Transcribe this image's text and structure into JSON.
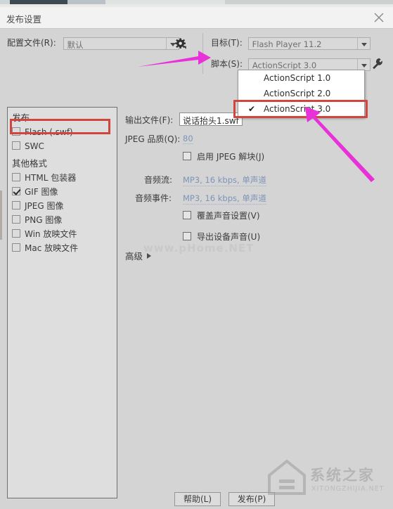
{
  "window": {
    "title": "发布设置",
    "close_icon": "close-icon"
  },
  "toolbar": {
    "profile_label": "配置文件(R):",
    "profile_value": "默认",
    "gear_icon": "gear-icon",
    "target_label": "目标(T):",
    "target_value": "Flash Player 11.2",
    "script_label": "脚本(S):",
    "script_value": "ActionScript 3.0",
    "wrench_icon": "wrench-icon"
  },
  "script_dropdown": {
    "options": [
      {
        "label": "ActionScript 1.0",
        "checked": false
      },
      {
        "label": "ActionScript 2.0",
        "checked": false
      },
      {
        "label": "ActionScript 3.0",
        "checked": true
      }
    ],
    "check_glyph": "✔",
    "highlight_color": "#d0463f"
  },
  "publish_panel": {
    "group1_title": "发布",
    "group1_items": [
      {
        "label": "Flash (.swf)",
        "checked": false
      },
      {
        "label": "SWC",
        "checked": false
      }
    ],
    "group2_title": "其他格式",
    "group2_items": [
      {
        "label": "HTML 包装器",
        "checked": false
      },
      {
        "label": "GIF 图像",
        "checked": true
      },
      {
        "label": "JPEG 图像",
        "checked": false
      },
      {
        "label": "PNG 图像",
        "checked": false
      },
      {
        "label": "Win 放映文件",
        "checked": false
      },
      {
        "label": "Mac 放映文件",
        "checked": false
      }
    ],
    "highlight_color": "#d0463f"
  },
  "form": {
    "output_label": "输出文件(F):",
    "output_value": "说话抬头1.swf",
    "jpeg_quality_label": "JPEG 品质(Q):",
    "jpeg_quality_value": "80",
    "jpeg_deblock_label": "启用 JPEG 解块(J)",
    "jpeg_deblock_checked": false,
    "audio_stream_label": "音频流:",
    "audio_stream_value": "MP3, 16 kbps, 单声道",
    "audio_event_label": "音频事件:",
    "audio_event_value": "MP3, 16 kbps, 单声道",
    "override_sound_label": "覆盖声音设置(V)",
    "override_sound_checked": false,
    "export_device_sound_label": "导出设备声音(U)",
    "export_device_sound_checked": false,
    "advanced_label": "高级"
  },
  "footer": {
    "help_label": "帮助(L)",
    "publish_label": "发布(P)"
  },
  "watermarks": {
    "center": "www.pHome.NET",
    "brand": "系统之家",
    "brand_sub": "XITONGZHIJIA.NET"
  },
  "annotations": {
    "arrow_color": "#e831d8"
  }
}
